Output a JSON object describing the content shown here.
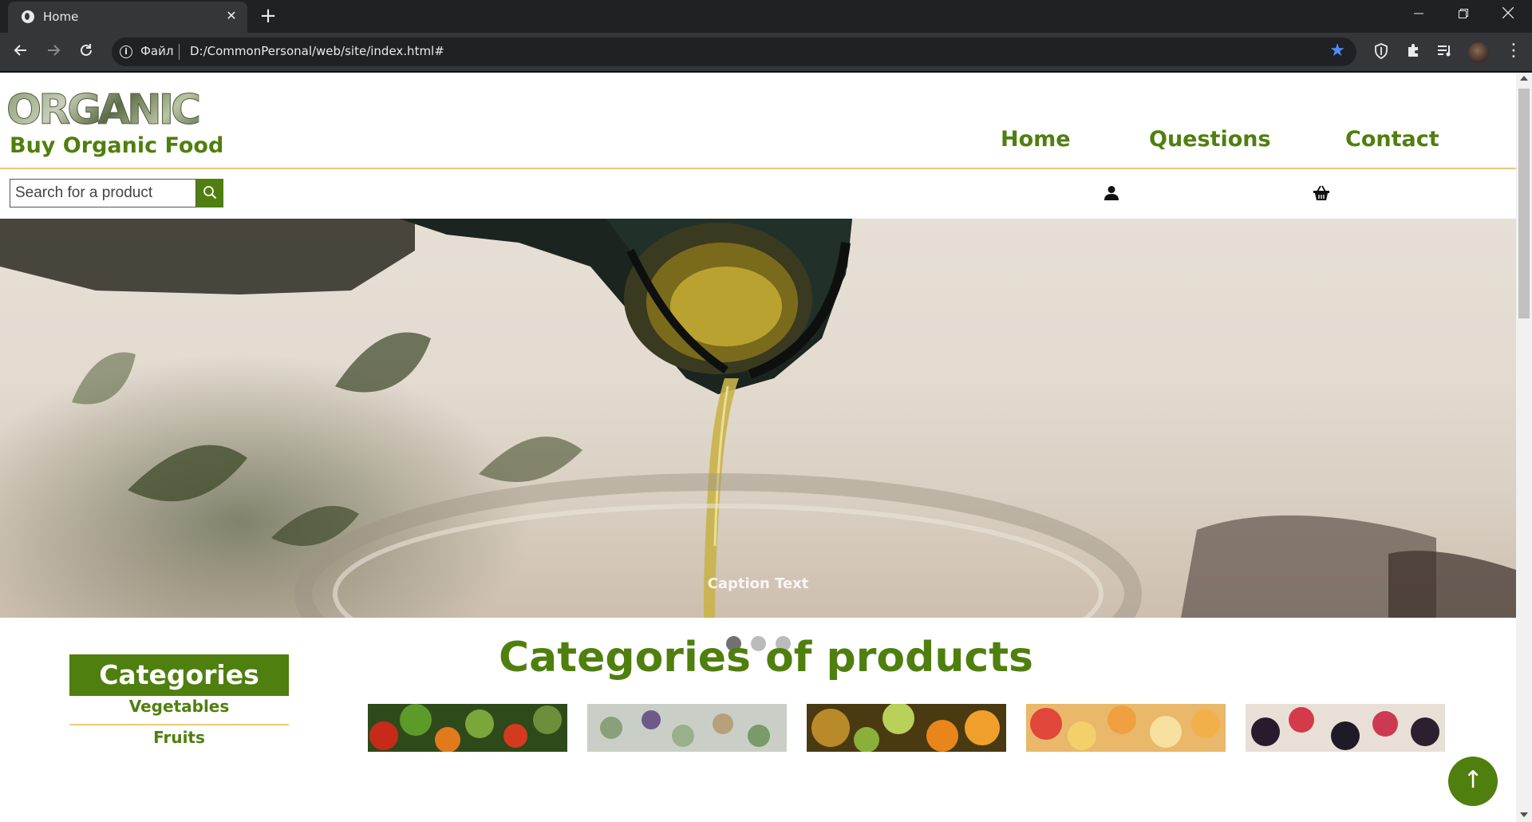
{
  "browser": {
    "tab_title": "Home",
    "new_tab_symbol": "+",
    "scheme_label": "Файл",
    "url": "D:/CommonPersonal/web/site/index.html#"
  },
  "site": {
    "logo_word": "ORGANIC",
    "logo_tagline": "Buy Organic Food",
    "nav": [
      {
        "label": "Home"
      },
      {
        "label": "Questions"
      },
      {
        "label": "Contact"
      }
    ],
    "search": {
      "placeholder": "Search for a product",
      "value": ""
    },
    "slideshow": {
      "caption": "Caption Text",
      "slide_count": 3,
      "active_index": 0
    },
    "sidebar": {
      "title": "Categories",
      "items": [
        {
          "label": "Vegetables"
        },
        {
          "label": "Fruits"
        }
      ]
    },
    "categories_heading": "Categories of products",
    "back_to_top_symbol": "↑"
  },
  "colors": {
    "brand_green": "#4f7f0e",
    "accent_gold": "#f0c97a",
    "chrome_dark": "#202124",
    "chrome_toolbar": "#35363a",
    "bookmark_star": "#4f8ef7"
  }
}
